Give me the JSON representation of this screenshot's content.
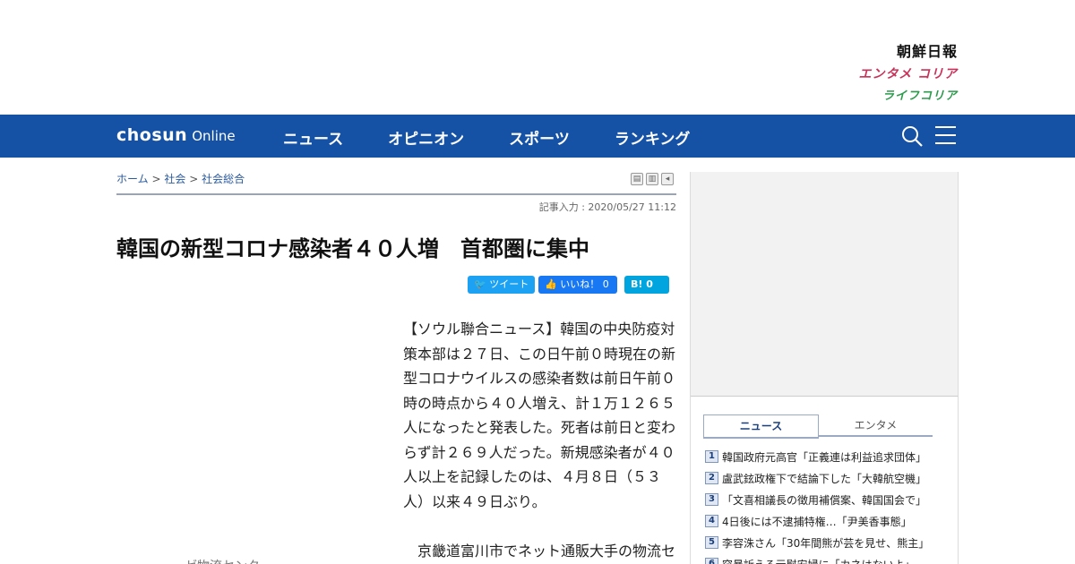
{
  "brand": {
    "main": "朝鮮日報",
    "entame": "エンタメ コリア",
    "life": "ライフコリア"
  },
  "nav": {
    "logo_bold": "chosun",
    "logo_light": "Online",
    "items": [
      "ニュース",
      "オピニオン",
      "スポーツ",
      "ランキング"
    ],
    "icons": [
      "search-icon",
      "menu-icon"
    ]
  },
  "breadcrumb": {
    "home": "ホーム",
    "sep": ">",
    "section": "社会",
    "subsection": "社会総合"
  },
  "article": {
    "posted": "記事入力 : 2020/05/27 11:12",
    "title": "韓国の新型コロナ感染者４０人増　首都圏に集中",
    "para1": "【ソウル聯合ニュース】韓国の中央防疫対策本部は２７日、この日午前０時現在の新型コロナウイルスの感染者数は前日午前０時の時点から４０人増え、計１万１２６５人になったと発表した。死者は前日と変わらず計２６９人だった。新規感染者が４０人以上を記録したのは、４月８日（５３人）以来４９日ぶり。",
    "para2": "京畿道富川市でネット通販大手の物流セ",
    "caption_fragment": "ゼ物流センター"
  },
  "social": {
    "tweet": "ツイート",
    "like": "いいね！ 0",
    "hatena": "B! 0"
  },
  "sidebar": {
    "tabs": [
      "ニュース",
      "エンタメ"
    ],
    "ranking": [
      {
        "num": "1",
        "text": "韓国政府元高官「正義連は利益追求団体」"
      },
      {
        "num": "2",
        "text": "盧武鉉政権下で結論下した「大韓航空機」"
      },
      {
        "num": "3",
        "text": "「文喜相議長の徴用補償案、韓国国会で」"
      },
      {
        "num": "4",
        "text": "4日後には不逮捕特権…「尹美香事態」"
      },
      {
        "num": "5",
        "text": "李容洙さん「30年間熊が芸を見せ、熊主」"
      },
      {
        "num": "6",
        "text": "突暴訴える元慰安婦に「カネはないよ」"
      }
    ]
  },
  "colors": {
    "nav_bg": "#1552a5",
    "link": "#2a5a9e",
    "entame": "#c8325a",
    "life": "#2c9a4b"
  }
}
